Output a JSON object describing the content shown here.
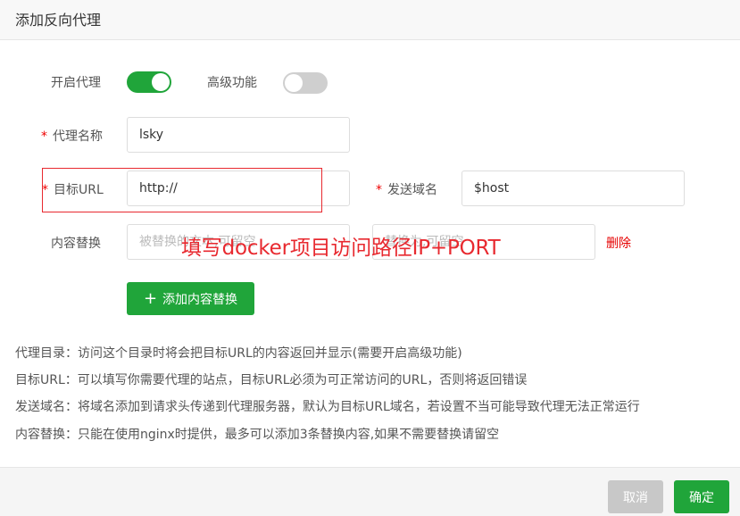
{
  "dialog": {
    "title": "添加反向代理"
  },
  "form": {
    "enable_proxy": {
      "label": "开启代理",
      "state": "on"
    },
    "advanced": {
      "label": "高级功能",
      "state": "off"
    },
    "proxy_name": {
      "label": "代理名称",
      "required": "*",
      "value": "lsky"
    },
    "target_url": {
      "label": "目标URL",
      "required": "*",
      "value": "http://"
    },
    "send_domain": {
      "label": "发送域名",
      "required": "*",
      "value": "$host"
    },
    "content_replace": {
      "label": "内容替换",
      "placeholder_left": "被替换的文本,可留空",
      "placeholder_right": "替换为,可留空",
      "delete_label": "删除",
      "add_label": "添加内容替换"
    }
  },
  "annotation": {
    "text": "填写docker项目访问路径IP+PORT"
  },
  "help": [
    "代理目录：访问这个目录时将会把目标URL的内容返回并显示(需要开启高级功能)",
    "目标URL：可以填写你需要代理的站点，目标URL必须为可正常访问的URL，否则将返回错误",
    "发送域名：将域名添加到请求头传递到代理服务器，默认为目标URL域名，若设置不当可能导致代理无法正常运行",
    "内容替换：只能在使用nginx时提供，最多可以添加3条替换内容,如果不需要替换请留空"
  ],
  "footer": {
    "cancel_label": "取消",
    "confirm_label": "确定"
  },
  "colors": {
    "accent": "#20a53a",
    "annotation": "#e8292f",
    "required": "#ef0000"
  }
}
